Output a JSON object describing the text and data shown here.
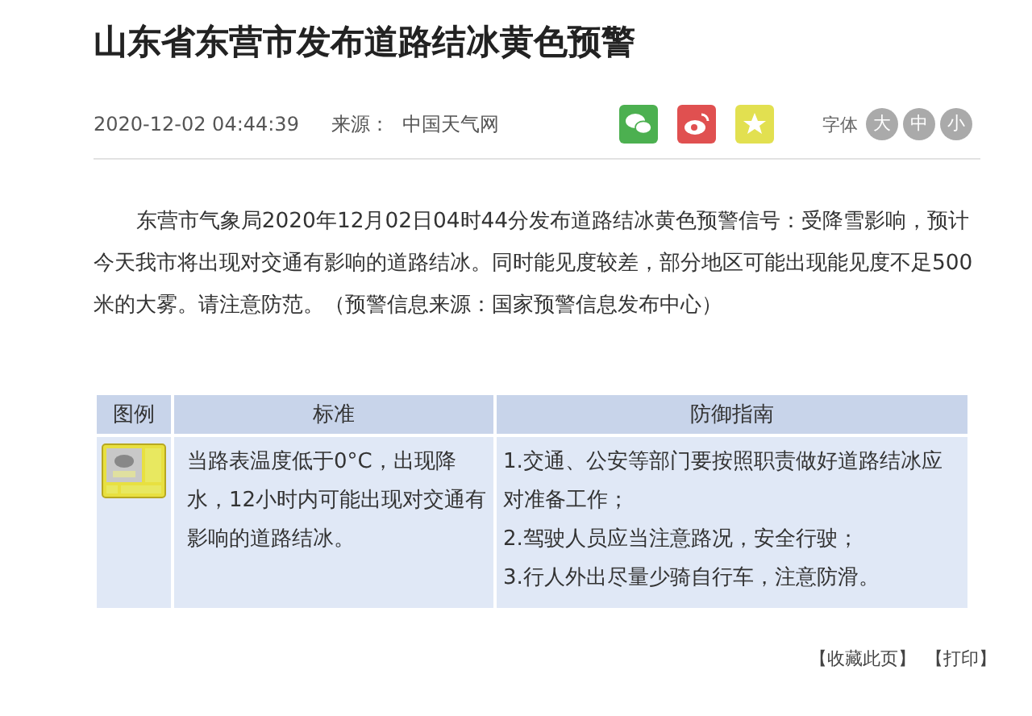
{
  "title": "山东省东营市发布道路结冰黄色预警",
  "meta": {
    "datetime": "2020-12-02 04:44:39",
    "source_label": "来源：",
    "source": "中国天气网"
  },
  "share": [
    {
      "kind": "wechat",
      "color": "#4cb050"
    },
    {
      "kind": "weibo",
      "color": "#e05050"
    },
    {
      "kind": "favorite",
      "color": "#e2e050"
    }
  ],
  "font_size": {
    "label": "字体",
    "options": [
      {
        "label": "大",
        "selected": false
      },
      {
        "label": "中",
        "selected": false
      },
      {
        "label": "小",
        "selected": false
      }
    ]
  },
  "body": "东营市气象局2020年12月02日04时44分发布道路结冰黄色预警信号：受降雪影响，预计今天我市将出现对交通有影响的道路结冰。同时能见度较差，部分地区可能出现能见度不足500米的大雾。请注意防范。（预警信息来源：国家预警信息发布中心）",
  "table": {
    "columns": [
      "图例",
      "标准",
      "防御指南"
    ],
    "rows": [
      {
        "standard": "当路表温度低于0°C，出现降水，12小时内可能出现对交通有影响的道路结冰。",
        "guide": [
          "1.交通、公安等部门要按照职责做好道路结冰应对准备工作；",
          "2.驾驶人员应当注意路况，安全行驶；",
          "3.行人外出尽量少骑自行车，注意防滑。"
        ]
      }
    ]
  },
  "footer": [
    "【收藏此页】",
    "【打印】"
  ]
}
